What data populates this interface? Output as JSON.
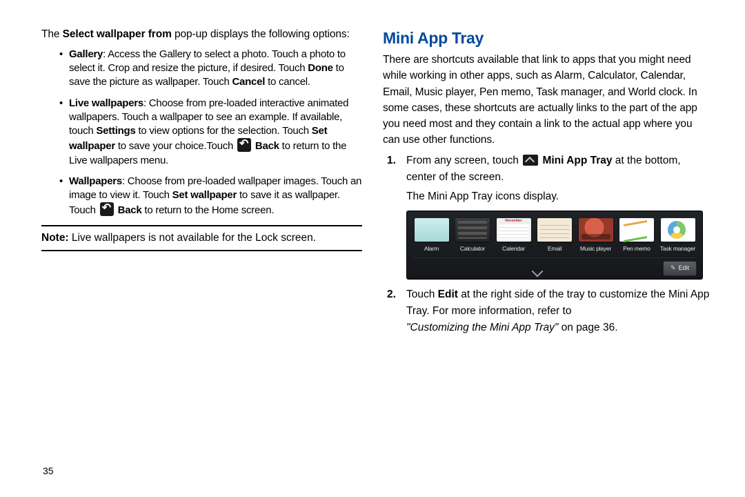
{
  "left": {
    "intro_a": "The ",
    "intro_b_bold": "Select wallpaper from",
    "intro_c": " pop-up displays the following options:",
    "bullets": [
      {
        "label": "Gallery",
        "rest_a": ": Access the Gallery to select a photo. Touch a photo to select it. Crop and resize the picture, if desired. Touch ",
        "bold_b": "Done",
        "rest_b": " to save the picture as wallpaper. Touch ",
        "bold_c": "Cancel",
        "rest_c": " to cancel."
      },
      {
        "label": "Live wallpapers",
        "rest_a": ": Choose from pre-loaded interactive animated wallpapers. Touch a wallpaper to see an example. If available, touch ",
        "bold_b": "Settings",
        "rest_b": " to view options for the selection. Touch ",
        "bold_c": "Set wallpaper",
        "rest_c": " to save your choice.Touch ",
        "back_bold": "Back",
        "tail": " to return to the Live wallpapers menu."
      },
      {
        "label": "Wallpapers",
        "rest_a": ": Choose from pre-loaded wallpaper images. Touch an image to view it. Touch ",
        "bold_b": "Set wallpaper",
        "rest_b": " to save it as wallpaper. Touch ",
        "back_bold": "Back",
        "tail": " to return to the Home screen."
      }
    ],
    "note_label": "Note:",
    "note_text": " Live wallpapers is not available for the Lock screen."
  },
  "right": {
    "heading": "Mini App Tray",
    "intro": "There are shortcuts available that link to apps that you might need while working in other apps, such as Alarm, Calculator, Calendar, Email, Music player, Pen memo, Task manager, and World clock. In some cases, these shortcuts are actually links to the part of the app you need most and they contain a link to the actual app where you can use other functions.",
    "step1_a": "From any screen, touch ",
    "step1_b_bold": "Mini App Tray",
    "step1_c": " at the bottom, center of the screen.",
    "step1_d": "The Mini App Tray icons display.",
    "tray_items": [
      "Alarm",
      "Calculator",
      "Calendar",
      "Email",
      "Music player",
      "Pen memo",
      "Task manager"
    ],
    "tray_edit": "Edit",
    "step2_a": "Touch ",
    "step2_b_bold": "Edit",
    "step2_c": " at the right side of the tray to customize the Mini App Tray. For more information, refer to ",
    "step2_ref_ital": "\"Customizing the Mini App Tray\" ",
    "step2_ref_tail": " on page 36."
  },
  "page_number": "35"
}
